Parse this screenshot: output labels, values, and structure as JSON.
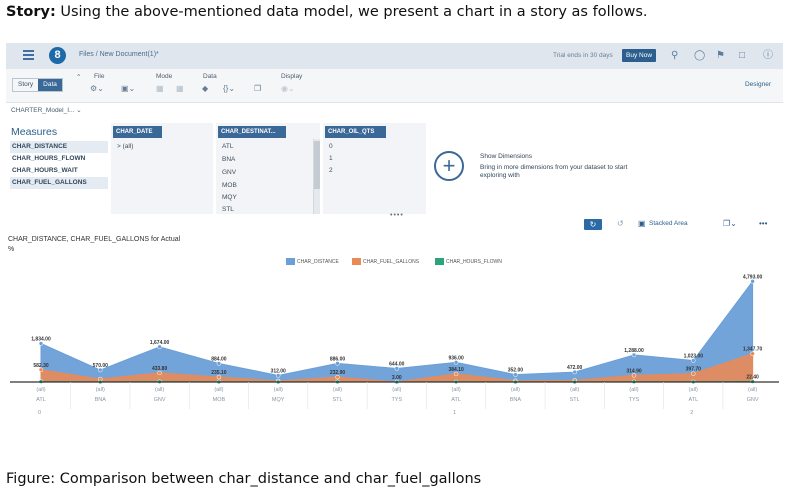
{
  "intro": {
    "bold": "Story:",
    "text": " Using the above-mentioned data model, we present a chart in a story as follows."
  },
  "caption": "Figure: Comparison between char_distance and char_fuel_gallons",
  "shell": {
    "logo_letter": "8",
    "breadcrumb": "Files  /  New Document(1)*",
    "trial": "Trial ends in 30 days",
    "buy_now": "Buy Now",
    "icons": [
      "search-icon",
      "lightbulb-icon",
      "megaphone-icon",
      "chat-icon",
      "help-icon"
    ]
  },
  "toolbar": {
    "story_label": "Story",
    "data_label": "Data",
    "file_label": "File",
    "mode_label": "Mode",
    "data_group_label": "Data",
    "display_label": "Display",
    "designer_label": "Designer"
  },
  "model_name": "CHARTER_Model_I... ⌄",
  "measures": {
    "title": "Measures",
    "items": [
      "CHAR_DISTANCE",
      "CHAR_HOURS_FLOWN",
      "CHAR_HOURS_WAIT",
      "CHAR_FUEL_GALLONS"
    ]
  },
  "dimensions": [
    {
      "header": "CHAR_DATE",
      "items": [
        "> (all)"
      ]
    },
    {
      "header": "CHAR_DESTINAT...",
      "items": [
        "ATL",
        "BNA",
        "GNV",
        "MOB",
        "MQY",
        "STL"
      ]
    },
    {
      "header": "CHAR_OIL_QTS",
      "items": [
        "0",
        "1",
        "2"
      ]
    }
  ],
  "show_dimensions": {
    "title": "Show Dimensions",
    "subtitle": "Bring in more dimensions from your dataset to start exploring with"
  },
  "chart_toolbar": {
    "chart_type_label": "Stacked Area",
    "more": "•••"
  },
  "chart": {
    "title": "CHAR_DISTANCE, CHAR_FUEL_GALLONS for Actual",
    "subtitle": "%"
  },
  "chart_data": {
    "type": "area",
    "stacked": true,
    "title": "CHAR_DISTANCE, CHAR_FUEL_GALLONS for Actual",
    "categories": [
      "ATL",
      "BNA",
      "GNV",
      "MOB",
      "MQY",
      "STL",
      "TYS",
      "ATL",
      "BNA",
      "STL",
      "TYS",
      "ATL",
      "GNV"
    ],
    "category_top_labels": [
      "(all)",
      "(all)",
      "(all)",
      "(all)",
      "(all)",
      "(all)",
      "(all)",
      "(all)",
      "(all)",
      "(all)",
      "(all)",
      "(all)",
      "(all)"
    ],
    "outer_groups": [
      {
        "label": "0",
        "start_index": 0
      },
      {
        "label": "1",
        "start_index": 7
      },
      {
        "label": "2",
        "start_index": 11
      }
    ],
    "legend_position": "top",
    "series": [
      {
        "name": "CHAR_DISTANCE",
        "color": "#6a9fd8",
        "values": [
          1834.0,
          570.0,
          1674.0,
          884.0,
          312.0,
          886.0,
          644.0,
          936.0,
          352.0,
          472.0,
          1288.0,
          1023.0,
          4793.0
        ],
        "labels": [
          "1,834.00",
          "570.00",
          "1,674.00",
          "884.00",
          "312.00",
          "886.00",
          "644.00",
          "936.00",
          "352.00",
          "472.00",
          "1,288.00",
          "1,023.00",
          "4,793.00"
        ]
      },
      {
        "name": "CHAR_FUEL_GALLONS",
        "color": "#ea8a55",
        "values": [
          582.3,
          140,
          433.8,
          235.1,
          50,
          232.9,
          3.0,
          384.1,
          60,
          80,
          314.9,
          397.7,
          1347.7
        ],
        "labels": [
          "582.30",
          "",
          "433.80",
          "235.10",
          "",
          "232.90",
          "3.00",
          "384.10",
          "",
          "",
          "314.90",
          "397.70",
          "1,347.70"
        ]
      },
      {
        "name": "CHAR_HOURS_FLOWN",
        "color": "#2aa579",
        "values": [
          20,
          5,
          15,
          8,
          3,
          8,
          1,
          9,
          3,
          4,
          12,
          9,
          22.4
        ],
        "labels": [
          "",
          "",
          "",
          "",
          "",
          "",
          "",
          "",
          "",
          "",
          "",
          "",
          "22.40"
        ]
      }
    ],
    "ylim": [
      0,
      5000
    ],
    "grid": false
  }
}
